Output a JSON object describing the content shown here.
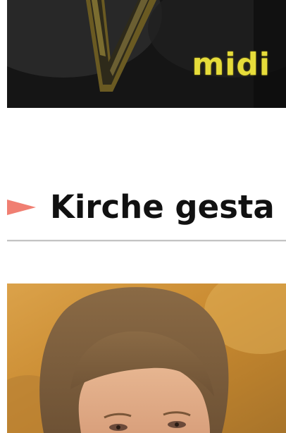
{
  "banner": {
    "wordmark": "midi"
  },
  "section": {
    "heading": "Kirche gesta"
  },
  "colors": {
    "arrow": "#f07f72",
    "wordmark": "#e6dc3a",
    "rule": "#c4c4c4"
  },
  "icons": {
    "heading_marker": "triangle-right-icon"
  }
}
